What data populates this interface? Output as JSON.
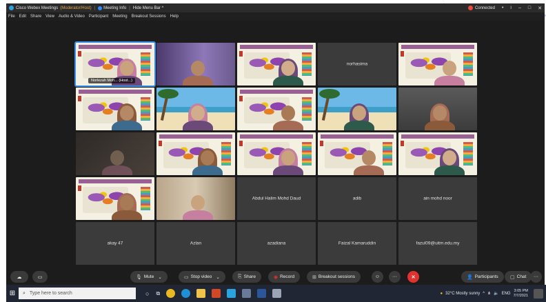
{
  "window": {
    "title": "Cisco Webex Meetings",
    "subtitle": "(Moderator/Host)",
    "meeting_info": "Meeting Info",
    "hide_menu": "Hide Menu Bar ^",
    "status": "Connected",
    "controls": [
      "•",
      "i",
      "–",
      "□",
      "✕"
    ]
  },
  "menu": [
    "File",
    "Edit",
    "Share",
    "View",
    "Audio & Video",
    "Participant",
    "Meeting",
    "Breakout Sessions",
    "Help"
  ],
  "tiles": [
    {
      "kind": "slide-person",
      "label": "Norlezah Moh... (Host...)",
      "active": true
    },
    {
      "kind": "purple-person"
    },
    {
      "kind": "slide-person"
    },
    {
      "kind": "name",
      "label": "norhasima"
    },
    {
      "kind": "slide-person"
    },
    {
      "kind": "slide-person"
    },
    {
      "kind": "beach-person"
    },
    {
      "kind": "slide-person"
    },
    {
      "kind": "beach-person"
    },
    {
      "kind": "gray-person"
    },
    {
      "kind": "dark-person"
    },
    {
      "kind": "slide-person"
    },
    {
      "kind": "slide-person"
    },
    {
      "kind": "slide-person"
    },
    {
      "kind": "slide-person"
    },
    {
      "kind": "slide-person"
    },
    {
      "kind": "home-person"
    },
    {
      "kind": "name",
      "label": "Abdul Halim Mohd Daud"
    },
    {
      "kind": "name",
      "label": "adib"
    },
    {
      "kind": "name",
      "label": "ain mohd noor"
    },
    {
      "kind": "name",
      "label": "akay 47"
    },
    {
      "kind": "name",
      "label": "Azlan"
    },
    {
      "kind": "name",
      "label": "azadiana"
    },
    {
      "kind": "name",
      "label": "Faizal Kamaruddin"
    },
    {
      "kind": "name",
      "label": "fazul09@uitm.edu.my"
    }
  ],
  "toolbar": {
    "mute": "Mute",
    "stop_video": "Stop video",
    "share": "Share",
    "record": "Record",
    "breakout": "Breakout sessions",
    "participants": "Participants",
    "chat": "Chat",
    "more": "···",
    "end": "✕"
  },
  "taskbar": {
    "search_placeholder": "Type here to search",
    "weather": "32°C  Mostly sunny",
    "lang": "ENG",
    "time": "3:05 PM",
    "date": "7/7/2021"
  },
  "colors": {
    "accent": "#3a8ee6",
    "end_call": "#e0332f",
    "title_sub": "#e7a94a"
  }
}
